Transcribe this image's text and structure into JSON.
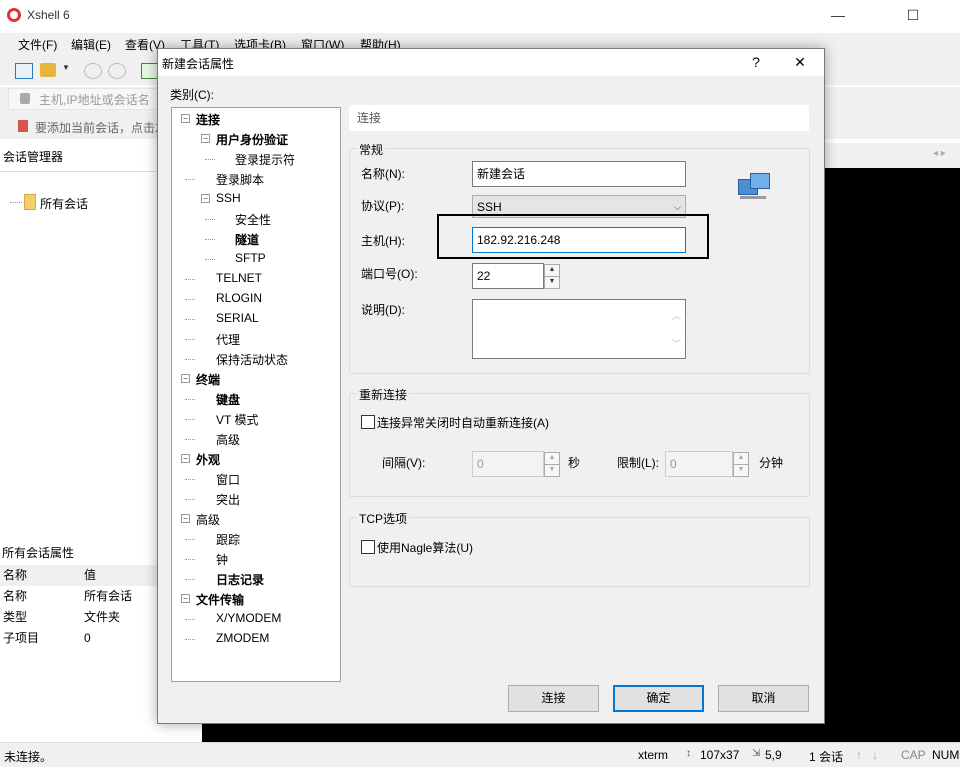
{
  "app": {
    "title": "Xshell 6",
    "menu": [
      "文件(F)",
      "编辑(E)",
      "查看(V)",
      "工具(T)",
      "选项卡(B)",
      "窗口(W)",
      "帮助(H)"
    ],
    "address_placeholder": "主机,IP地址或会话名称",
    "hint": "要添加当前会话，点击左",
    "session_manager": "会话管理器",
    "tree_root": "所有会话",
    "props_title": "所有会话属性",
    "props_headers": [
      "名称",
      "值"
    ],
    "props_rows": [
      [
        "名称",
        "所有会话"
      ],
      [
        "类型",
        "文件夹"
      ],
      [
        "子项目",
        "0"
      ]
    ]
  },
  "status": {
    "text": "未连接。",
    "term": "xterm",
    "size": "107x37",
    "pos": "5,9",
    "sessions": "1 会话",
    "caps": "CAP",
    "num": "NUM"
  },
  "dialog": {
    "title": "新建会话属性",
    "help": "?",
    "close": "✕",
    "category_label": "类别(C):",
    "tree": [
      {
        "label": "连接",
        "bold": true,
        "level": 0,
        "expander": "−"
      },
      {
        "label": "用户身份验证",
        "bold": true,
        "level": 1,
        "expander": "−"
      },
      {
        "label": "登录提示符",
        "bold": false,
        "level": 2
      },
      {
        "label": "登录脚本",
        "bold": false,
        "level": 1
      },
      {
        "label": "SSH",
        "bold": false,
        "level": 1,
        "expander": "−"
      },
      {
        "label": "安全性",
        "bold": false,
        "level": 2
      },
      {
        "label": "隧道",
        "bold": true,
        "level": 2
      },
      {
        "label": "SFTP",
        "bold": false,
        "level": 2
      },
      {
        "label": "TELNET",
        "bold": false,
        "level": 1
      },
      {
        "label": "RLOGIN",
        "bold": false,
        "level": 1
      },
      {
        "label": "SERIAL",
        "bold": false,
        "level": 1
      },
      {
        "label": "代理",
        "bold": false,
        "level": 1
      },
      {
        "label": "保持活动状态",
        "bold": false,
        "level": 1
      },
      {
        "label": "终端",
        "bold": true,
        "level": 0,
        "expander": "−"
      },
      {
        "label": "键盘",
        "bold": true,
        "level": 1
      },
      {
        "label": "VT 模式",
        "bold": false,
        "level": 1
      },
      {
        "label": "高级",
        "bold": false,
        "level": 1
      },
      {
        "label": "外观",
        "bold": true,
        "level": 0,
        "expander": "−"
      },
      {
        "label": "窗口",
        "bold": false,
        "level": 1
      },
      {
        "label": "突出",
        "bold": false,
        "level": 1
      },
      {
        "label": "高级",
        "bold": false,
        "level": 0,
        "expander": "−"
      },
      {
        "label": "跟踪",
        "bold": false,
        "level": 1
      },
      {
        "label": "钟",
        "bold": false,
        "level": 1
      },
      {
        "label": "日志记录",
        "bold": true,
        "level": 1
      },
      {
        "label": "文件传输",
        "bold": true,
        "level": 0,
        "expander": "−"
      },
      {
        "label": "X/YMODEM",
        "bold": false,
        "level": 1
      },
      {
        "label": "ZMODEM",
        "bold": false,
        "level": 1
      }
    ],
    "section": "连接",
    "general": {
      "title": "常规",
      "name_label": "名称(N):",
      "name_value": "新建会话",
      "protocol_label": "协议(P):",
      "protocol_value": "SSH",
      "host_label": "主机(H):",
      "host_value": "182.92.216.248",
      "port_label": "端口号(O):",
      "port_value": "22",
      "desc_label": "说明(D):"
    },
    "reconnect": {
      "title": "重新连接",
      "checkbox_label": "连接异常关闭时自动重新连接(A)",
      "interval_label": "间隔(V):",
      "interval_value": "0",
      "interval_unit": "秒",
      "limit_label": "限制(L):",
      "limit_value": "0",
      "limit_unit": "分钟"
    },
    "tcp": {
      "title": "TCP选项",
      "checkbox_label": "使用Nagle算法(U)"
    },
    "buttons": {
      "connect": "连接",
      "ok": "确定",
      "cancel": "取消"
    }
  }
}
